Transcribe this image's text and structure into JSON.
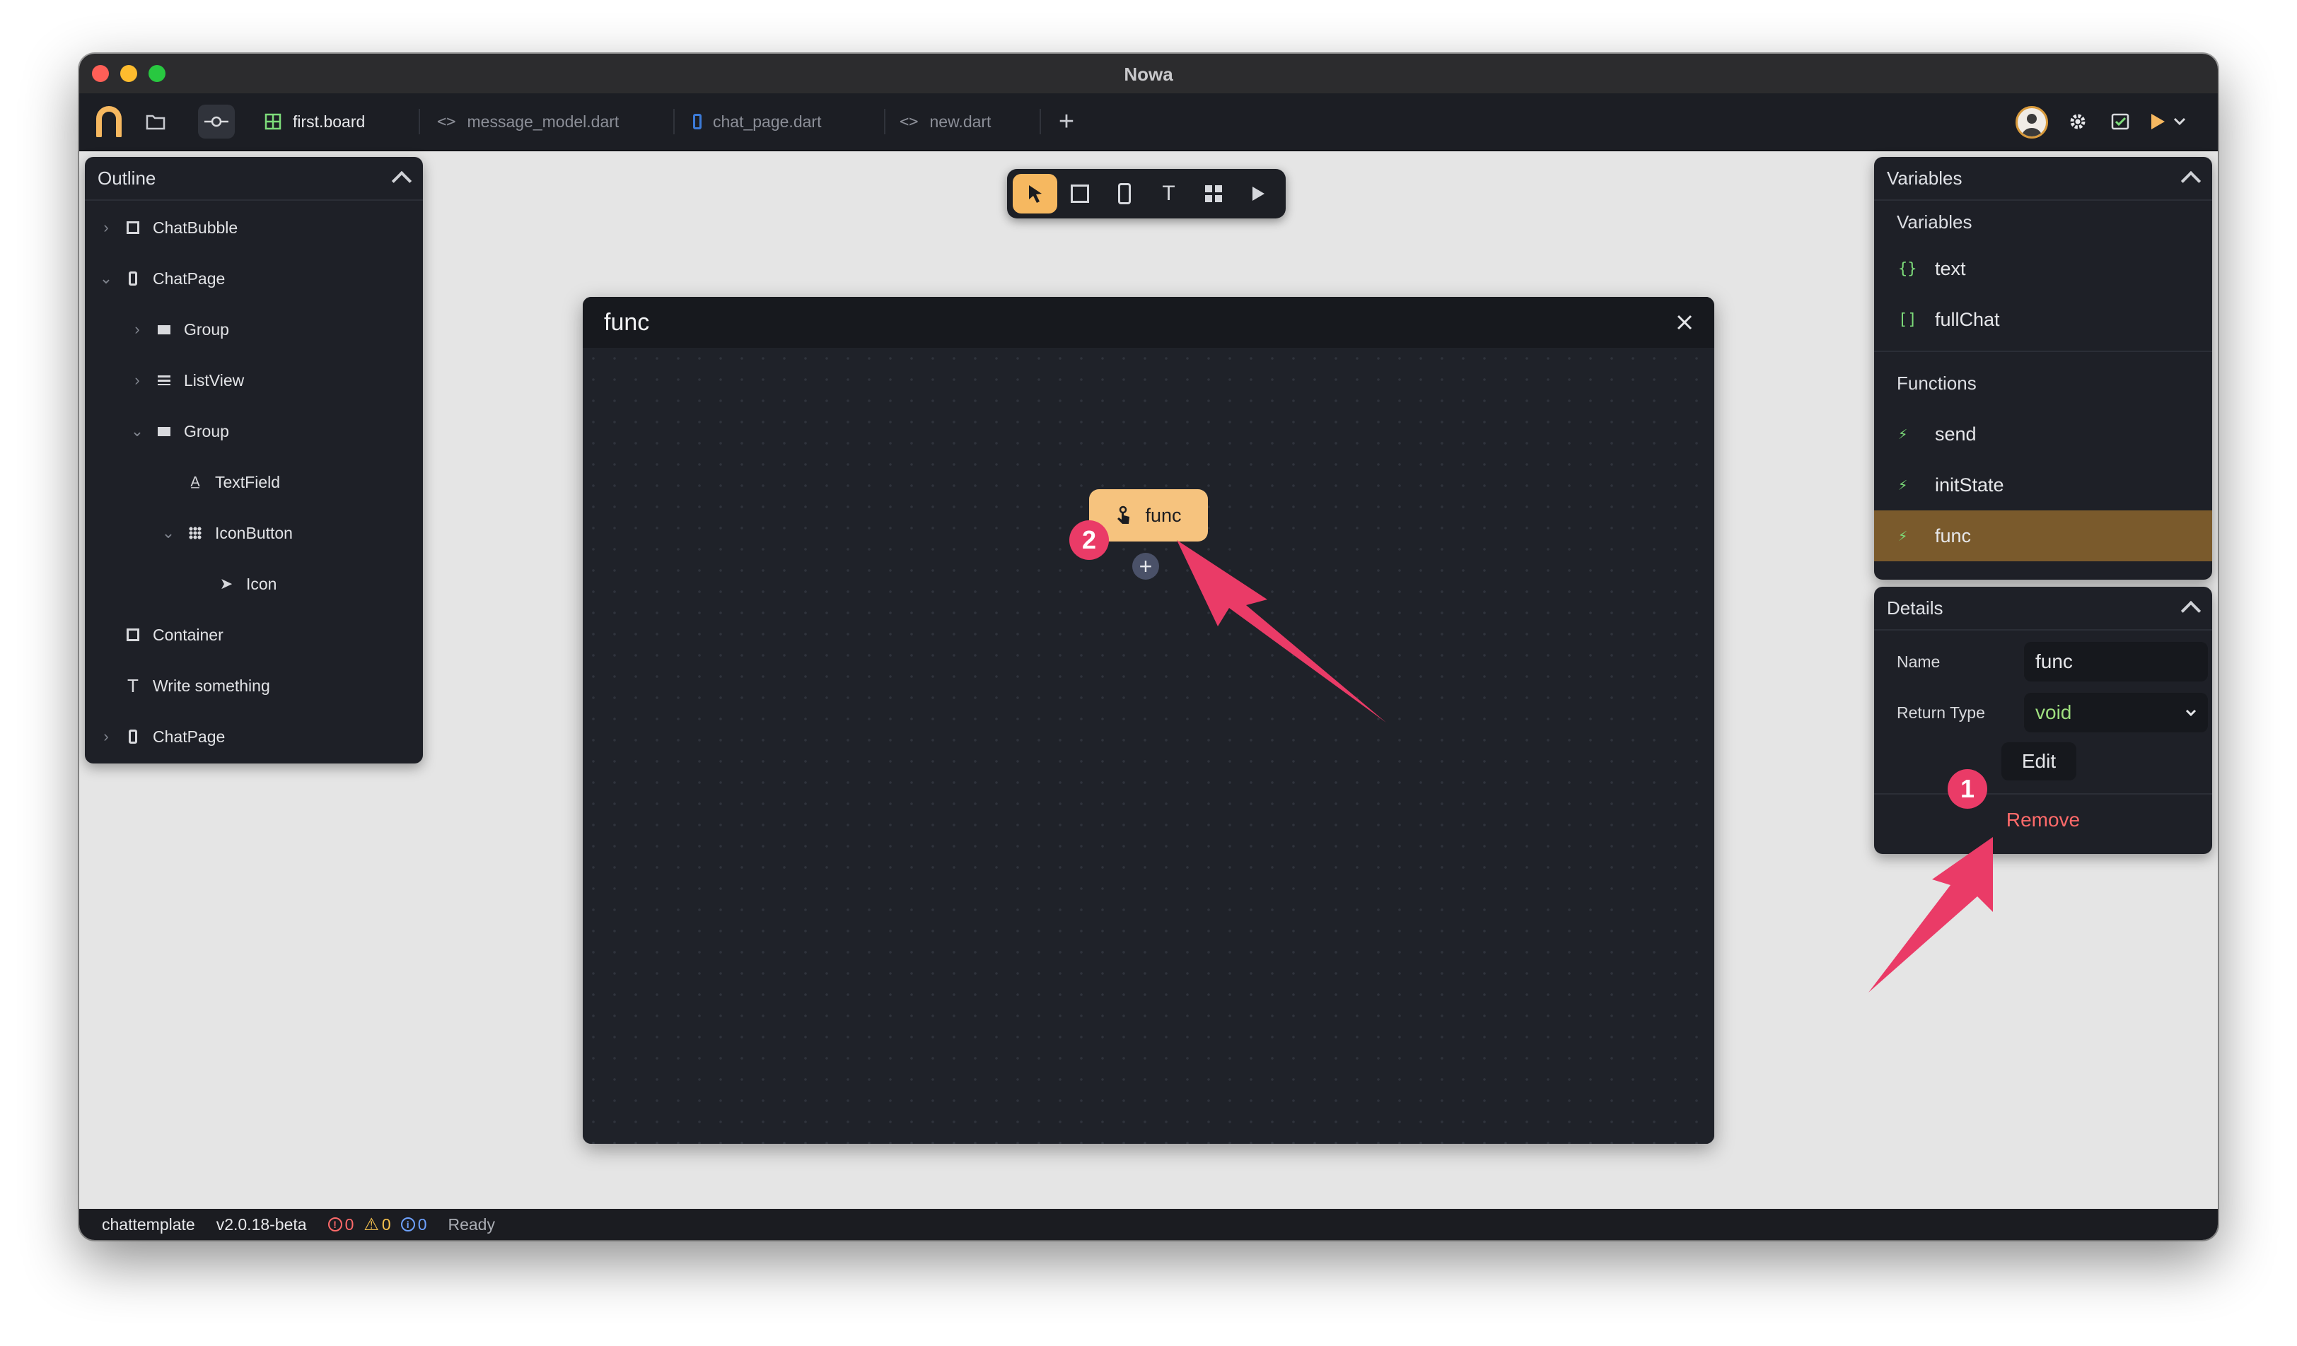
{
  "window": {
    "title": "Nowa"
  },
  "tabs": [
    {
      "label": "first.board",
      "icon": "board-grid-icon",
      "active": true
    },
    {
      "label": "message_model.dart",
      "icon": "code-icon",
      "active": false
    },
    {
      "label": "chat_page.dart",
      "icon": "phone-icon",
      "active": false
    },
    {
      "label": "new.dart",
      "icon": "code-icon",
      "active": false
    }
  ],
  "outline": {
    "title": "Outline",
    "items": [
      {
        "label": "ChatBubble",
        "icon": "box-icon",
        "caret": "right"
      },
      {
        "label": "ChatPage",
        "icon": "phone-icon",
        "caret": "down"
      },
      {
        "label": "Group",
        "icon": "group-icon",
        "caret": "right"
      },
      {
        "label": "ListView",
        "icon": "list-icon",
        "caret": "right"
      },
      {
        "label": "Group",
        "icon": "group-icon",
        "caret": "down"
      },
      {
        "label": "TextField",
        "icon": "textfield-icon",
        "caret": ""
      },
      {
        "label": "IconButton",
        "icon": "grid-icon",
        "caret": "down"
      },
      {
        "label": "Icon",
        "icon": "send-icon",
        "caret": ""
      },
      {
        "label": "Container",
        "icon": "box-icon",
        "caret": ""
      },
      {
        "label": "Write something",
        "icon": "text-icon",
        "caret": ""
      },
      {
        "label": "ChatPage",
        "icon": "phone-icon",
        "caret": "right"
      }
    ]
  },
  "toolbar": {
    "tools": [
      "pointer-icon",
      "rectangle-icon",
      "phone-icon",
      "text-icon",
      "widgets-icon",
      "play-icon"
    ]
  },
  "board": {
    "title": "func",
    "node_label": "func",
    "add_symbol": "+"
  },
  "annotations": {
    "badge_1": "1",
    "badge_2": "2",
    "color": "#ea3b67"
  },
  "variables_panel": {
    "title": "Variables",
    "variables_section": "Variables",
    "variables": [
      {
        "glyph": "{}",
        "name": "text"
      },
      {
        "glyph": "[]",
        "name": "fullChat"
      }
    ],
    "functions_section": "Functions",
    "functions": [
      {
        "name": "send",
        "selected": false
      },
      {
        "name": "initState",
        "selected": false
      },
      {
        "name": "func",
        "selected": true
      }
    ]
  },
  "details_panel": {
    "title": "Details",
    "name_label": "Name",
    "name_value": "func",
    "return_type_label": "Return Type",
    "return_type_value": "void",
    "edit_label": "Edit",
    "remove_label": "Remove"
  },
  "statusbar": {
    "project": "chattemplate",
    "version": "v2.0.18-beta",
    "errors": "0",
    "warnings": "0",
    "infos": "0",
    "status": "Ready"
  },
  "colors": {
    "accent": "#f6b860",
    "selected": "#7a5a2c",
    "remove": "#ff6a6a",
    "green": "#7ddc7a"
  }
}
